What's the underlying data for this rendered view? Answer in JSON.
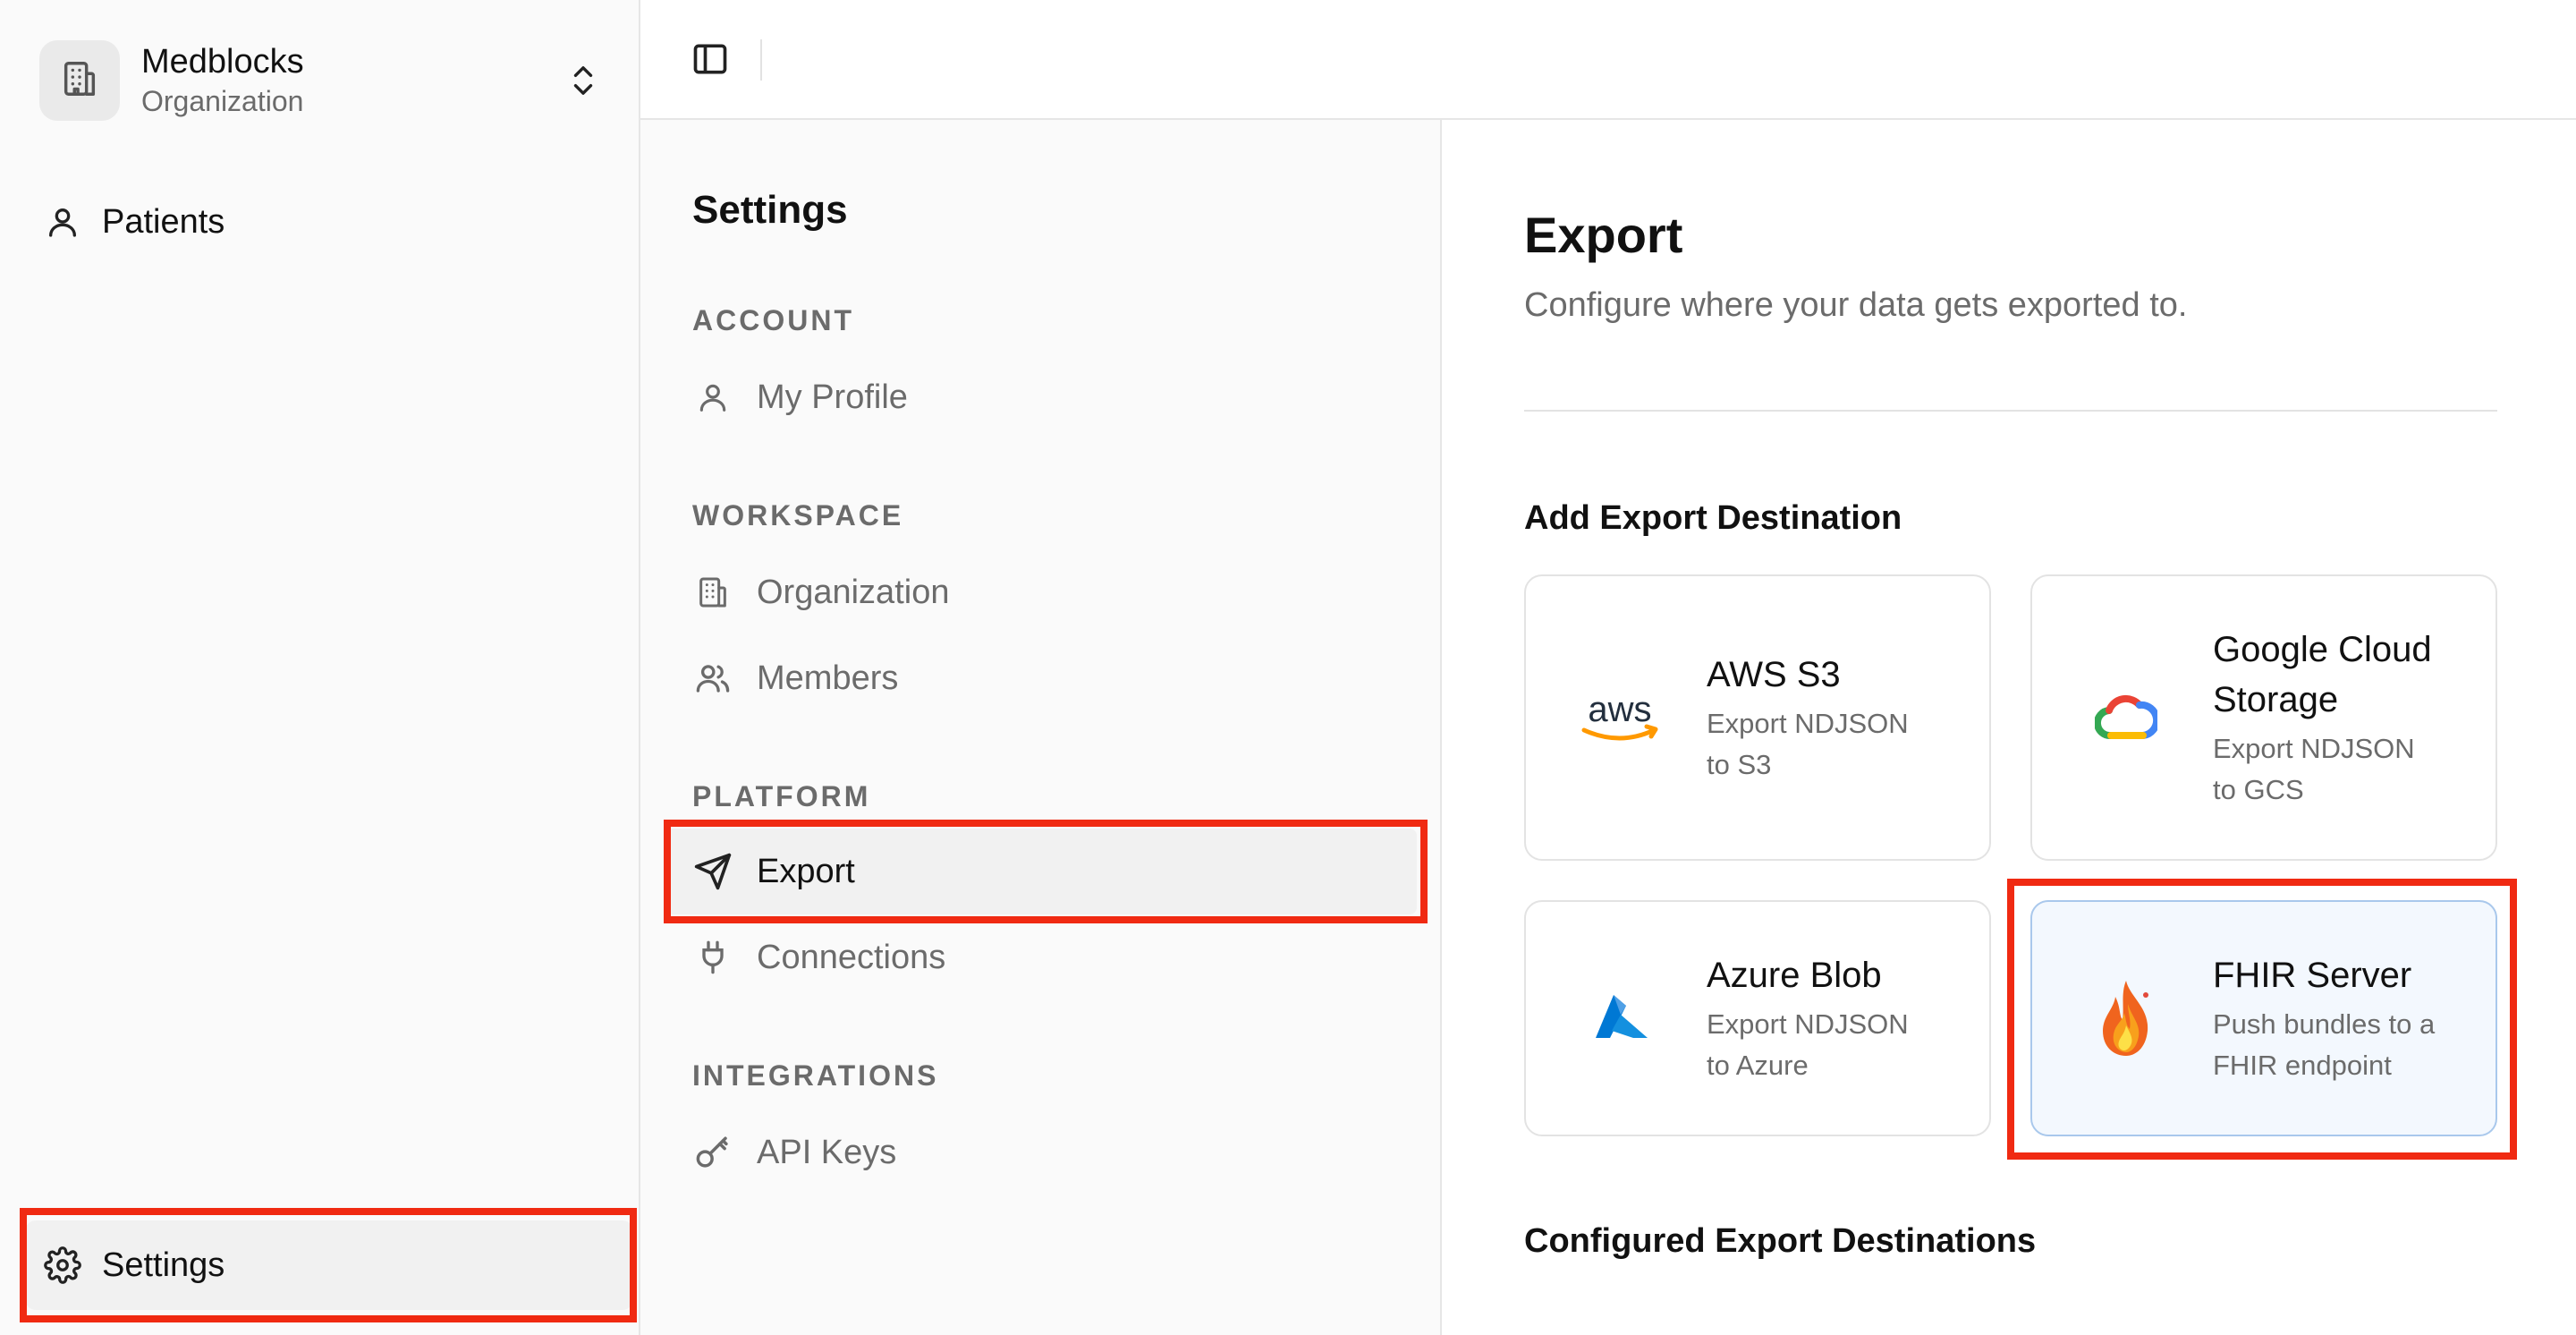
{
  "org": {
    "name": "Medblocks",
    "subtitle": "Organization"
  },
  "sidebar": {
    "items": [
      {
        "label": "Patients"
      }
    ],
    "footer": {
      "settings_label": "Settings"
    }
  },
  "settings_nav": {
    "title": "Settings",
    "sections": [
      {
        "heading": "ACCOUNT",
        "items": [
          {
            "label": "My Profile",
            "icon": "user-icon"
          }
        ]
      },
      {
        "heading": "WORKSPACE",
        "items": [
          {
            "label": "Organization",
            "icon": "building-icon"
          },
          {
            "label": "Members",
            "icon": "users-icon"
          }
        ]
      },
      {
        "heading": "PLATFORM",
        "items": [
          {
            "label": "Export",
            "icon": "send-icon",
            "active": true
          },
          {
            "label": "Connections",
            "icon": "plug-icon"
          }
        ]
      },
      {
        "heading": "INTEGRATIONS",
        "items": [
          {
            "label": "API Keys",
            "icon": "key-icon"
          }
        ]
      }
    ]
  },
  "main": {
    "title": "Export",
    "description": "Configure where your data gets exported to.",
    "add_heading": "Add Export Destination",
    "configured_heading": "Configured Export Destinations",
    "destinations": [
      {
        "title": "AWS S3",
        "desc_line1": "Export NDJSON",
        "desc_line2": "to S3",
        "icon": "aws-logo-icon"
      },
      {
        "title_line1": "Google Cloud",
        "title_line2": "Storage",
        "desc_line1": "Export NDJSON",
        "desc_line2": "to GCS",
        "icon": "google-cloud-logo-icon"
      },
      {
        "title": "Azure Blob",
        "desc_line1": "Export NDJSON",
        "desc_line2": "to Azure",
        "icon": "azure-logo-icon"
      },
      {
        "title": "FHIR Server",
        "desc_line1": "Push bundles to a",
        "desc_line2": "FHIR endpoint",
        "icon": "fhir-flame-icon",
        "selected": true
      }
    ]
  },
  "colors": {
    "highlight": "#f02a12",
    "aws_orange": "#ff9900",
    "azure_blue": "#0078d4",
    "selected_card_bg": "#f3f8fe"
  }
}
